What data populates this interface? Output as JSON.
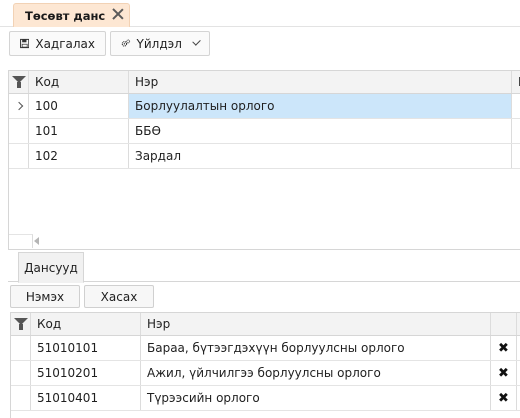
{
  "doc_tab": {
    "label": "Төсөвт данс"
  },
  "toolbar": {
    "save_label": "Хадгалах",
    "action_label": "Үйлдэл"
  },
  "accounts_grid": {
    "columns": {
      "code": "Код",
      "name": "Нэр",
      "extra": "E"
    },
    "rows": [
      {
        "code": "100",
        "name": "Борлуулалтын орлого",
        "selected": true
      },
      {
        "code": "101",
        "name": "ББӨ",
        "selected": false
      },
      {
        "code": "102",
        "name": "Зардал",
        "selected": false
      }
    ]
  },
  "sub_tab": {
    "label": "Дансууд"
  },
  "sub_toolbar": {
    "add_label": "Нэмэх",
    "remove_label": "Хасах"
  },
  "detail_grid": {
    "columns": {
      "code": "Код",
      "name": "Нэр"
    },
    "rows": [
      {
        "code": "51010101",
        "name": "Бараа, бүтээгдэхүүн борлуулсны орлого",
        "delete_icon": "✖"
      },
      {
        "code": "51010201",
        "name": "Ажил, үйлчилгээ борлуулсны орлого",
        "delete_icon": "✖"
      },
      {
        "code": "51010401",
        "name": "Түрээсийн орлого",
        "delete_icon": "✖"
      }
    ]
  },
  "colors": {
    "selected_row": "#cce6fa",
    "tab_active": "#fde7d3"
  }
}
